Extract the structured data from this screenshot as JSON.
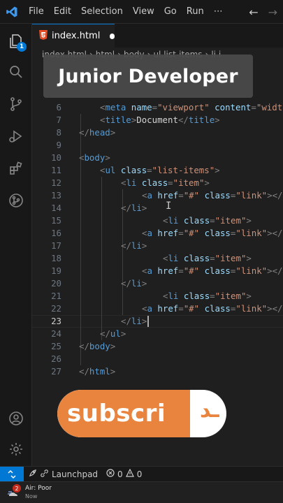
{
  "menu": [
    "File",
    "Edit",
    "Selection",
    "View",
    "Go",
    "Run",
    "⋯"
  ],
  "nav": {
    "back": "←",
    "forward": "→"
  },
  "activity": {
    "explorer_badge": "1"
  },
  "tab": {
    "filename": "index.html"
  },
  "breadcrumb": [
    "index.html",
    "html",
    "body",
    "ul.list-items",
    "li.i"
  ],
  "overlay_title": "Junior Developer",
  "editor": {
    "active_line": 23,
    "lines": [
      {
        "num": "6",
        "indent": 2,
        "tokens": [
          [
            "pun",
            "<"
          ],
          [
            "tag",
            "meta"
          ],
          [
            "txt",
            " "
          ],
          [
            "attr",
            "name"
          ],
          [
            "pun",
            "="
          ],
          [
            "str",
            "\"viewport\""
          ],
          [
            "txt",
            " "
          ],
          [
            "attr",
            "content"
          ],
          [
            "pun",
            "="
          ],
          [
            "str",
            "\"width"
          ]
        ]
      },
      {
        "num": "7",
        "indent": 2,
        "tokens": [
          [
            "pun",
            "<"
          ],
          [
            "tag",
            "title"
          ],
          [
            "pun",
            ">"
          ],
          [
            "txt",
            "Document"
          ],
          [
            "pun",
            "</"
          ],
          [
            "tag",
            "title"
          ],
          [
            "pun",
            ">"
          ]
        ]
      },
      {
        "num": "8",
        "indent": 1,
        "tokens": [
          [
            "pun",
            "</"
          ],
          [
            "tag",
            "head"
          ],
          [
            "pun",
            ">"
          ]
        ]
      },
      {
        "num": "9",
        "indent": 0,
        "tokens": []
      },
      {
        "num": "10",
        "indent": 1,
        "tokens": [
          [
            "pun",
            "<"
          ],
          [
            "tag",
            "body"
          ],
          [
            "pun",
            ">"
          ]
        ]
      },
      {
        "num": "11",
        "indent": 2,
        "tokens": [
          [
            "pun",
            "<"
          ],
          [
            "tag",
            "ul"
          ],
          [
            "txt",
            " "
          ],
          [
            "attr",
            "class"
          ],
          [
            "pun",
            "="
          ],
          [
            "str",
            "\"list-items\""
          ],
          [
            "pun",
            ">"
          ]
        ]
      },
      {
        "num": "12",
        "indent": 3,
        "tokens": [
          [
            "pun",
            "<"
          ],
          [
            "tag",
            "li"
          ],
          [
            "txt",
            " "
          ],
          [
            "attr",
            "class"
          ],
          [
            "pun",
            "="
          ],
          [
            "str",
            "\"item\""
          ],
          [
            "pun",
            ">"
          ]
        ]
      },
      {
        "num": "13",
        "indent": 4,
        "tokens": [
          [
            "pun",
            "<"
          ],
          [
            "tag",
            "a"
          ],
          [
            "txt",
            " "
          ],
          [
            "attr",
            "href"
          ],
          [
            "pun",
            "="
          ],
          [
            "str",
            "\"#\""
          ],
          [
            "txt",
            " "
          ],
          [
            "attr",
            "class"
          ],
          [
            "pun",
            "="
          ],
          [
            "str",
            "\"link\""
          ],
          [
            "pun",
            ">"
          ],
          [
            "pun",
            "</"
          ],
          [
            "tag",
            "a"
          ]
        ]
      },
      {
        "num": "14",
        "indent": 3,
        "tokens": [
          [
            "pun",
            "</"
          ],
          [
            "tag",
            "li"
          ],
          [
            "pun",
            ">"
          ]
        ]
      },
      {
        "num": "15",
        "indent": 5,
        "tokens": [
          [
            "pun",
            "<"
          ],
          [
            "tag",
            "li"
          ],
          [
            "txt",
            " "
          ],
          [
            "attr",
            "class"
          ],
          [
            "pun",
            "="
          ],
          [
            "str",
            "\"item\""
          ],
          [
            "pun",
            ">"
          ]
        ]
      },
      {
        "num": "16",
        "indent": 4,
        "tokens": [
          [
            "pun",
            "<"
          ],
          [
            "tag",
            "a"
          ],
          [
            "txt",
            " "
          ],
          [
            "attr",
            "href"
          ],
          [
            "pun",
            "="
          ],
          [
            "str",
            "\"#\""
          ],
          [
            "txt",
            " "
          ],
          [
            "attr",
            "class"
          ],
          [
            "pun",
            "="
          ],
          [
            "str",
            "\"link\""
          ],
          [
            "pun",
            ">"
          ],
          [
            "pun",
            "</"
          ],
          [
            "tag",
            "a"
          ]
        ]
      },
      {
        "num": "17",
        "indent": 3,
        "tokens": [
          [
            "pun",
            "</"
          ],
          [
            "tag",
            "li"
          ],
          [
            "pun",
            ">"
          ]
        ]
      },
      {
        "num": "18",
        "indent": 5,
        "tokens": [
          [
            "pun",
            "<"
          ],
          [
            "tag",
            "li"
          ],
          [
            "txt",
            " "
          ],
          [
            "attr",
            "class"
          ],
          [
            "pun",
            "="
          ],
          [
            "str",
            "\"item\""
          ],
          [
            "pun",
            ">"
          ]
        ]
      },
      {
        "num": "19",
        "indent": 4,
        "tokens": [
          [
            "pun",
            "<"
          ],
          [
            "tag",
            "a"
          ],
          [
            "txt",
            " "
          ],
          [
            "attr",
            "href"
          ],
          [
            "pun",
            "="
          ],
          [
            "str",
            "\"#\""
          ],
          [
            "txt",
            " "
          ],
          [
            "attr",
            "class"
          ],
          [
            "pun",
            "="
          ],
          [
            "str",
            "\"link\""
          ],
          [
            "pun",
            ">"
          ],
          [
            "pun",
            "</"
          ],
          [
            "tag",
            "a"
          ]
        ]
      },
      {
        "num": "20",
        "indent": 3,
        "tokens": [
          [
            "pun",
            "</"
          ],
          [
            "tag",
            "li"
          ],
          [
            "pun",
            ">"
          ]
        ]
      },
      {
        "num": "21",
        "indent": 5,
        "tokens": [
          [
            "pun",
            "<"
          ],
          [
            "tag",
            "li"
          ],
          [
            "txt",
            " "
          ],
          [
            "attr",
            "class"
          ],
          [
            "pun",
            "="
          ],
          [
            "str",
            "\"item\""
          ],
          [
            "pun",
            ">"
          ]
        ]
      },
      {
        "num": "22",
        "indent": 4,
        "tokens": [
          [
            "pun",
            "<"
          ],
          [
            "tag",
            "a"
          ],
          [
            "txt",
            " "
          ],
          [
            "attr",
            "href"
          ],
          [
            "pun",
            "="
          ],
          [
            "str",
            "\"#\""
          ],
          [
            "txt",
            " "
          ],
          [
            "attr",
            "class"
          ],
          [
            "pun",
            "="
          ],
          [
            "str",
            "\"link\""
          ],
          [
            "pun",
            ">"
          ],
          [
            "pun",
            "</"
          ],
          [
            "tag",
            "a"
          ]
        ]
      },
      {
        "num": "23",
        "indent": 3,
        "tokens": [
          [
            "pun",
            "</"
          ],
          [
            "tag",
            "li"
          ],
          [
            "pun",
            ">"
          ]
        ]
      },
      {
        "num": "24",
        "indent": 2,
        "tokens": [
          [
            "pun",
            "</"
          ],
          [
            "tag",
            "ul"
          ],
          [
            "pun",
            ">"
          ]
        ]
      },
      {
        "num": "25",
        "indent": 1,
        "tokens": [
          [
            "pun",
            "</"
          ],
          [
            "tag",
            "body"
          ],
          [
            "pun",
            ">"
          ]
        ]
      },
      {
        "num": "26",
        "indent": 0,
        "tokens": []
      },
      {
        "num": "27",
        "indent": 1,
        "tokens": [
          [
            "pun",
            "</"
          ],
          [
            "tag",
            "html"
          ],
          [
            "pun",
            ">"
          ]
        ]
      }
    ]
  },
  "subscribe": {
    "label": "subscri",
    "tail": "ـد"
  },
  "status": {
    "launchpad": "Launchpad",
    "errors": "0",
    "warnings": "0"
  },
  "taskbar": {
    "weather_badge": "2",
    "weather_line1": "Air: Poor",
    "weather_line2": "Now"
  },
  "colors": {
    "accent": "#0078d4",
    "subscribe": "#e8843d",
    "html5": "#e44d26"
  }
}
